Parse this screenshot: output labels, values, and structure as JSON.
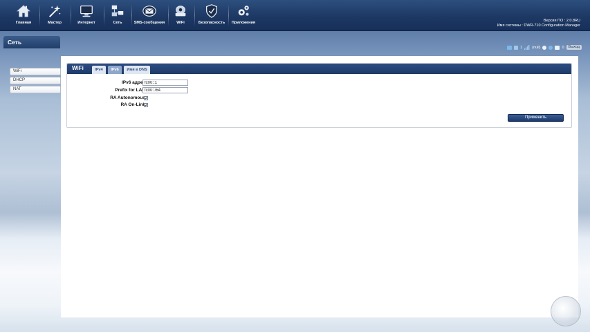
{
  "nav": {
    "items": [
      {
        "label": "Главная",
        "icon": "home-icon"
      },
      {
        "label": "Мастер",
        "icon": "wizard-icon"
      },
      {
        "label": "Интернет",
        "icon": "monitor-icon"
      },
      {
        "label": "Сеть",
        "icon": "network-icon"
      },
      {
        "label": "SMS-сообщения",
        "icon": "envelope-icon"
      },
      {
        "label": "WiFi",
        "icon": "router-icon"
      },
      {
        "label": "Безопасность",
        "icon": "shield-icon"
      },
      {
        "label": "Приложения",
        "icon": "gears-icon"
      }
    ]
  },
  "system": {
    "version_line": "Версия ПО : 2.0.8RU",
    "name_line": "Имя системы : DWR-710 Configuration Manager"
  },
  "sidebar": {
    "title": "Сеть",
    "items": [
      {
        "label": "WiFi"
      },
      {
        "label": "DHCP"
      },
      {
        "label": "NAT"
      }
    ]
  },
  "status": {
    "wifi_clients": "1",
    "signal_text": "(null)",
    "sms_count": "0",
    "logout_label": "Выход"
  },
  "panel": {
    "title": "WiFi",
    "tabs": [
      {
        "label": "IPv4",
        "active": false
      },
      {
        "label": "IPv6",
        "active": true
      },
      {
        "label": "Имя в DNS",
        "active": false
      }
    ],
    "fields": {
      "ipv6_address": {
        "label": "IPv6 адрес",
        "value": "fc00::1"
      },
      "prefix_lan": {
        "label": "Prefix for LAN",
        "value": "fc00::/64"
      },
      "ra_autonomous": {
        "label": "RA Autonomous",
        "checked": true
      },
      "ra_onlink": {
        "label": "RA On-Link",
        "checked": true
      }
    },
    "apply_label": "Применить"
  },
  "colors": {
    "header_blue": "#1d3863",
    "panel_header": "#1e3a68",
    "tab_active": "#8ea7cb"
  }
}
